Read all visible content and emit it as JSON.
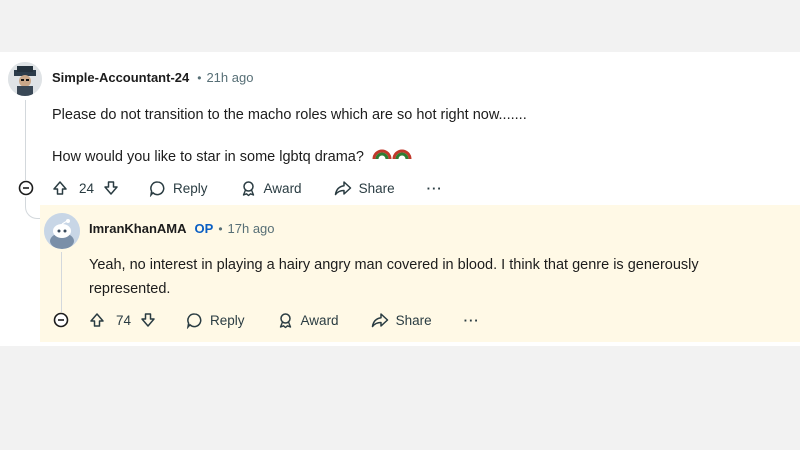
{
  "comments": [
    {
      "username": "Simple-Accountant-24",
      "time": "21h ago",
      "paragraphs": [
        "Please do not transition to the macho roles which are so hot right now.......",
        "How would you like to star in some lgbtq drama?"
      ],
      "votes": "24",
      "actions": {
        "reply": "Reply",
        "award": "Award",
        "share": "Share",
        "more": "···"
      }
    },
    {
      "username": "ImranKhanAMA",
      "badge": "OP",
      "time": "17h ago",
      "paragraphs": [
        "Yeah, no interest in playing a hairy angry man covered in blood. I think that genre is generously",
        "represented."
      ],
      "votes": "74",
      "actions": {
        "reply": "Reply",
        "award": "Award",
        "share": "Share",
        "more": "···"
      }
    }
  ],
  "separator": "•",
  "icons": [
    "collapse-icon",
    "upvote-icon",
    "downvote-icon",
    "comment-icon",
    "award-icon",
    "share-icon",
    "more-icon",
    "rainbow-emoji-icon"
  ],
  "colors": {
    "highlight": "#fff9e6",
    "op_badge": "#0a5fc4",
    "meta_text": "#576f76",
    "text": "#1c1c1c"
  }
}
